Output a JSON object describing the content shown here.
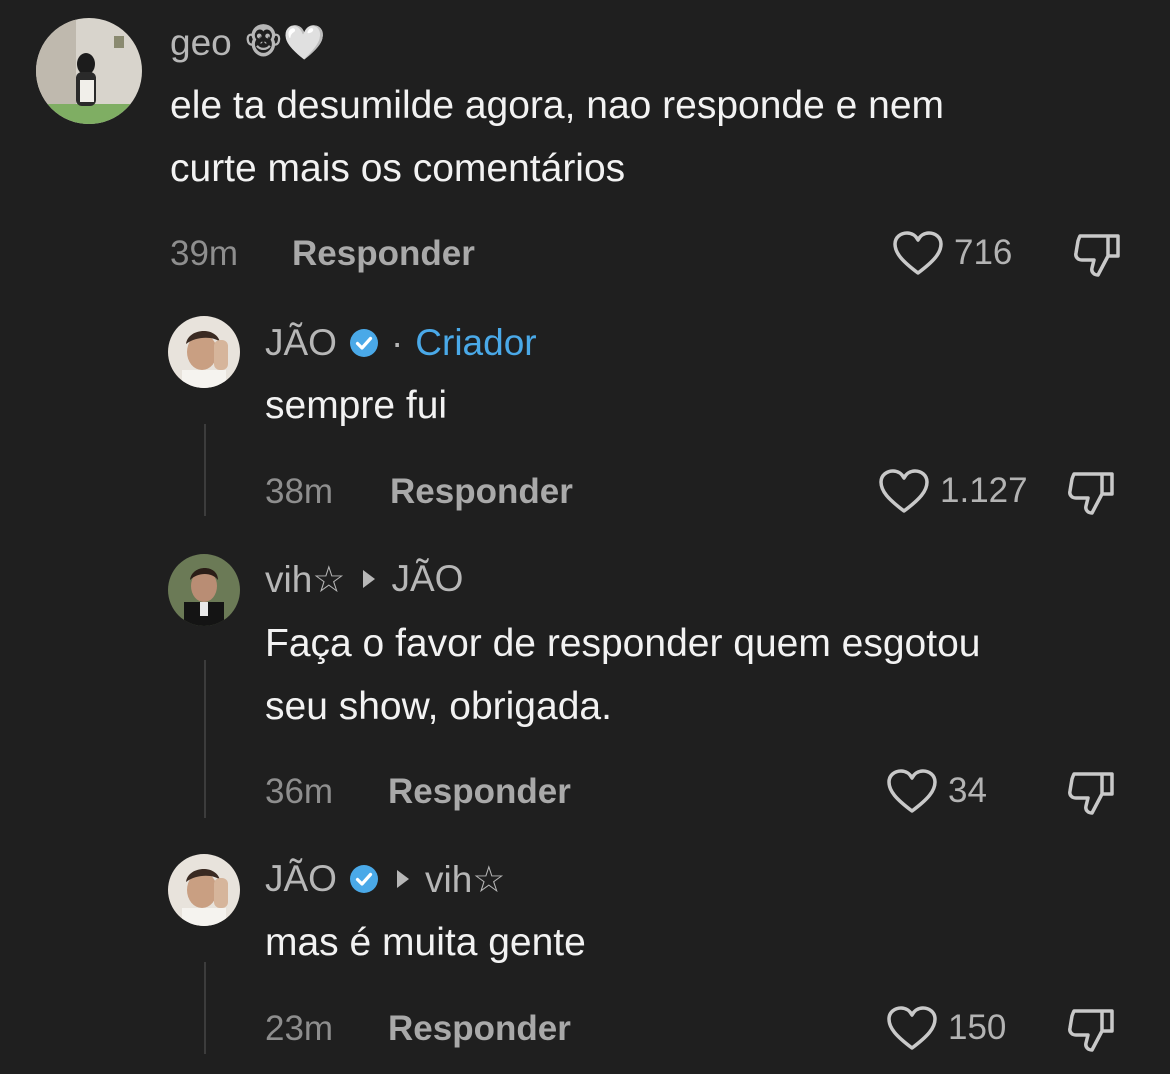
{
  "colors": {
    "background": "#1f1f1f",
    "creator": "#4aa9e8",
    "verified": "#4aa9e8"
  },
  "comments": [
    {
      "author": "geo",
      "author_emoji": "🐵🤍",
      "text_lines": [
        "ele ta desumilde agora, nao responde e nem",
        "curte mais os comentários"
      ],
      "time": "39m",
      "reply_label": "Responder",
      "likes": "716",
      "icons": [
        "heart-icon",
        "thumbs-down-icon"
      ]
    },
    {
      "author": "JÃO",
      "verified": true,
      "separator": "·",
      "badge": "Criador",
      "text_lines": [
        "sempre fui"
      ],
      "time": "38m",
      "reply_label": "Responder",
      "likes": "1.127",
      "icons": [
        "verified-icon",
        "heart-icon",
        "thumbs-down-icon"
      ]
    },
    {
      "author": "vih☆",
      "reply_to": "JÃO",
      "text_lines": [
        "Faça o favor de responder quem esgotou",
        "seu show, obrigada."
      ],
      "time": "36m",
      "reply_label": "Responder",
      "likes": "34",
      "icons": [
        "reply-arrow-icon",
        "heart-icon",
        "thumbs-down-icon"
      ]
    },
    {
      "author": "JÃO",
      "verified": true,
      "reply_to": "vih☆",
      "text_lines": [
        "mas é muita gente"
      ],
      "time": "23m",
      "reply_label": "Responder",
      "likes": "150",
      "icons": [
        "verified-icon",
        "reply-arrow-icon",
        "heart-icon",
        "thumbs-down-icon"
      ]
    }
  ]
}
